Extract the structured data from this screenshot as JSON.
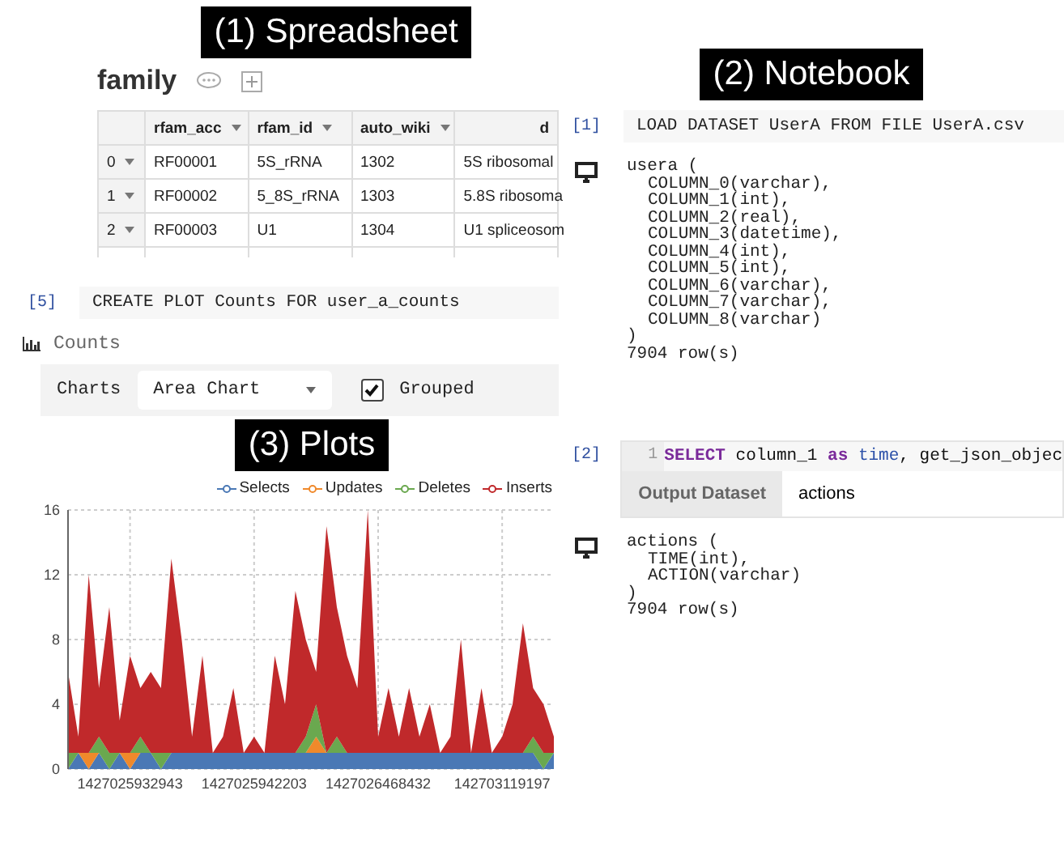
{
  "spreadsheet": {
    "caption": "(1) Spreadsheet",
    "title": "family",
    "table": {
      "columns": [
        "rfam_acc",
        "rfam_id",
        "auto_wiki",
        "d"
      ],
      "rows": [
        {
          "index": "0",
          "cells": [
            "RF00001",
            "5S_rRNA",
            "1302",
            "5S ribosomal"
          ]
        },
        {
          "index": "1",
          "cells": [
            "RF00002",
            "5_8S_rRNA",
            "1303",
            "5.8S ribosoma"
          ]
        },
        {
          "index": "2",
          "cells": [
            "RF00003",
            "U1",
            "1304",
            "U1 spliceosom"
          ]
        }
      ]
    }
  },
  "plot_cell": {
    "prompt": "[5]",
    "code": "CREATE PLOT Counts FOR user_a_counts",
    "heading": "Counts",
    "controls": {
      "label": "Charts",
      "chart_type": "Area Chart",
      "grouped_label": "Grouped",
      "grouped_checked": true
    },
    "caption": "(3) Plots",
    "chart_data": {
      "type": "area",
      "stacked": true,
      "categories": [
        null,
        null,
        null,
        null,
        null,
        null,
        "1427025932943",
        null,
        null,
        null,
        null,
        null,
        null,
        null,
        null,
        null,
        null,
        null,
        "1427025942203",
        null,
        null,
        null,
        null,
        null,
        null,
        null,
        null,
        null,
        null,
        null,
        "1427026468432",
        null,
        null,
        null,
        null,
        null,
        null,
        null,
        null,
        null,
        null,
        null,
        "142703119197",
        null,
        null,
        null,
        null,
        null
      ],
      "series": [
        {
          "name": "Selects",
          "color": "#4a78b5",
          "values": [
            0,
            1,
            0,
            1,
            0,
            1,
            0,
            1,
            1,
            0,
            1,
            1,
            1,
            1,
            1,
            1,
            1,
            1,
            1,
            1,
            1,
            1,
            1,
            1,
            1,
            1,
            1,
            1,
            1,
            1,
            1,
            1,
            1,
            1,
            1,
            1,
            1,
            1,
            1,
            1,
            1,
            1,
            1,
            1,
            1,
            1,
            0,
            1
          ]
        },
        {
          "name": "Updates",
          "color": "#f0892b",
          "values": [
            0,
            0,
            1,
            0,
            0,
            0,
            1,
            0,
            0,
            0,
            0,
            0,
            0,
            0,
            0,
            0,
            0,
            0,
            0,
            0,
            0,
            0,
            0,
            0,
            1,
            0,
            0,
            0,
            0,
            0,
            0,
            0,
            0,
            0,
            0,
            0,
            0,
            0,
            0,
            0,
            0,
            0,
            0,
            0,
            0,
            0,
            0,
            0
          ]
        },
        {
          "name": "Deletes",
          "color": "#6aa84f",
          "values": [
            1,
            0,
            0,
            1,
            1,
            0,
            0,
            1,
            0,
            1,
            0,
            0,
            0,
            0,
            0,
            0,
            0,
            0,
            0,
            0,
            0,
            0,
            0,
            1,
            2,
            0,
            1,
            0,
            0,
            0,
            0,
            0,
            0,
            0,
            0,
            0,
            0,
            0,
            0,
            0,
            0,
            0,
            0,
            0,
            0,
            1,
            1,
            0
          ]
        },
        {
          "name": "Inserts",
          "color": "#c0292b",
          "values": [
            5,
            1,
            11,
            3,
            9,
            2,
            6,
            3,
            5,
            4,
            12,
            7,
            1,
            6,
            0,
            1,
            4,
            0,
            1,
            0,
            6,
            3,
            10,
            6,
            2,
            14,
            8,
            6,
            4,
            15,
            1,
            4,
            1,
            4,
            1,
            3,
            0,
            1,
            7,
            0,
            4,
            0,
            1,
            3,
            8,
            3,
            3,
            1
          ]
        }
      ],
      "ylim": [
        0,
        16
      ],
      "yticks": [
        0,
        4,
        8,
        12,
        16
      ],
      "grid": true
    }
  },
  "notebook": {
    "caption": "(2) Notebook",
    "cells": [
      {
        "prompt": "[1]",
        "kind": "plain",
        "code": "LOAD DATASET UserA FROM FILE UserA.csv",
        "output": {
          "header": "usera (",
          "columns": [
            "COLUMN_0(varchar),",
            "COLUMN_1(int),",
            "COLUMN_2(real),",
            "COLUMN_3(datetime),",
            "COLUMN_4(int),",
            "COLUMN_5(int),",
            "COLUMN_6(varchar),",
            "COLUMN_7(varchar),",
            "COLUMN_8(varchar)"
          ],
          "close": ")",
          "rows": "7904 row(s)"
        }
      },
      {
        "prompt": "[2]",
        "kind": "sql",
        "line_number": "1",
        "tokens": [
          {
            "text": "SELECT",
            "kind": "keyword"
          },
          {
            "text": "column_1",
            "kind": "plain"
          },
          {
            "text": "as",
            "kind": "keyword"
          },
          {
            "text": "time",
            "kind": "builtin"
          },
          {
            "text": ",",
            "kind": "punct"
          },
          {
            "text": "get_json_objec",
            "kind": "plain"
          }
        ],
        "output_dataset": {
          "label": "Output Dataset",
          "value": "actions"
        },
        "output": {
          "header": "actions (",
          "columns": [
            "TIME(int),",
            "ACTION(varchar)"
          ],
          "close": ")",
          "rows": "7904 row(s)"
        }
      }
    ]
  }
}
